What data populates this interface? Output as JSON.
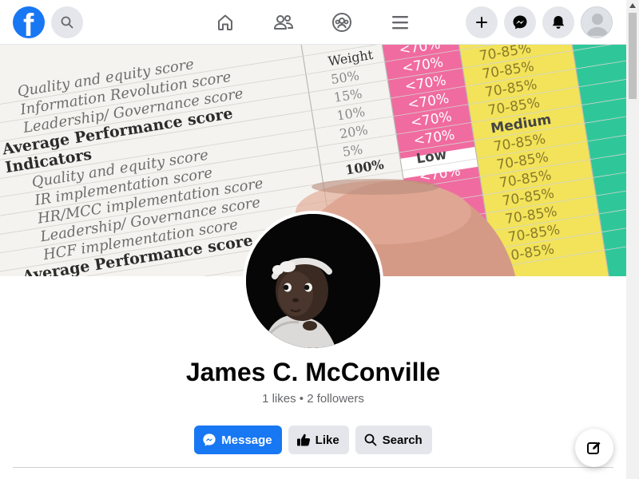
{
  "header": {
    "logo_letter": "f",
    "icons": {
      "search": "search-icon",
      "home": "home-icon",
      "friends": "friends-icon",
      "groups": "groups-icon",
      "menu": "menu-icon",
      "create": "plus-icon",
      "messenger": "messenger-icon",
      "notifications": "bell-icon",
      "account": "avatar-icon"
    }
  },
  "cover": {
    "rows": [
      {
        "text": "Quality and equity score",
        "weight": "",
        "low": "<70%",
        "mid": "70-85%"
      },
      {
        "text": "Information Revolution score",
        "weight": "Weight",
        "low": "<70%",
        "mid": "70-85%"
      },
      {
        "text": "Leadership/ Governance score",
        "weight": "50%",
        "low": "<70%",
        "mid": "70-85%"
      },
      {
        "text": "Average Performance score",
        "weight": "15%",
        "low": "<70%",
        "mid": "70-85%"
      },
      {
        "text": "Indicators",
        "weight": "10%",
        "low": "<70%",
        "mid": "70-85%"
      },
      {
        "text": "Quality and equity score",
        "weight": "20%",
        "low": "<70%",
        "mid": "70-85%"
      },
      {
        "text": "IR implementation score",
        "weight": "5%",
        "low": "<70%",
        "mid": "Medium"
      },
      {
        "text": "HR/MCC implementation score",
        "weight": "100%",
        "low": "Low",
        "mid": "70-85%"
      },
      {
        "text": "Leadership/ Governance score",
        "weight": "",
        "low": "<70%",
        "mid": "70-85%"
      },
      {
        "text": "HCF implementation score",
        "weight": "",
        "low": "",
        "mid": "70-85%"
      },
      {
        "text": "Average Performance score",
        "weight": "",
        "low": "",
        "mid": "70-85%"
      },
      {
        "text": "Indicators",
        "weight": "",
        "low": "",
        "mid": "70-85%"
      },
      {
        "text": "Quality and equity score",
        "weight": "",
        "low": "",
        "mid": "70-85%"
      },
      {
        "text": "implementation score",
        "weight": "",
        "low": "",
        "mid": "0-85%"
      }
    ],
    "top_weight": "100%",
    "top_low": "Low",
    "top_mid": "70-85%"
  },
  "profile": {
    "name": "James C. McConville",
    "stats": "1 likes • 2 followers"
  },
  "actions": {
    "message": "Message",
    "like": "Like",
    "search": "Search"
  },
  "colors": {
    "brand": "#1877f2",
    "button_secondary": "#e4e6eb",
    "text_secondary": "#65676b",
    "cover_pink": "#f06ba0",
    "cover_yellow": "#f2e35a",
    "cover_green": "#2fc79a"
  }
}
